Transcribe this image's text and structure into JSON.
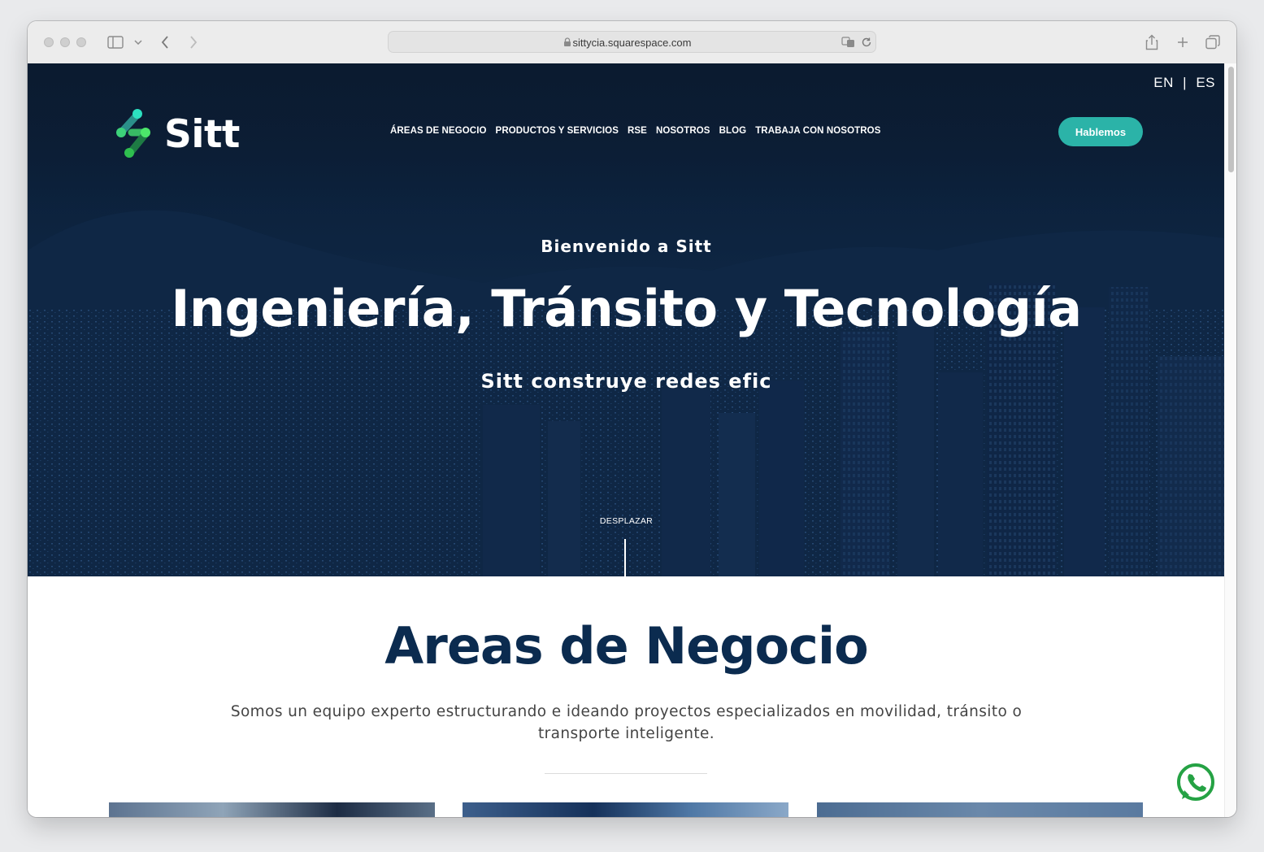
{
  "browser": {
    "url": "sittycia.squarespace.com"
  },
  "site": {
    "brand": "Sitt",
    "lang": {
      "en": "EN",
      "sep": "|",
      "es": "ES"
    },
    "nav": [
      "ÁREAS DE NEGOCIO",
      "PRODUCTOS Y SERVICIOS",
      "RSE",
      "NOSOTROS",
      "BLOG",
      "TRABAJA CON NOSOTROS"
    ],
    "cta": "Hablemos"
  },
  "hero": {
    "eyebrow": "Bienvenido a Sitt",
    "title": "Ingeniería, Tránsito y Tecnología",
    "subtitle": "Sitt construye redes efic",
    "scroll_label": "DESPLAZAR"
  },
  "areas": {
    "title": "Areas de Negocio",
    "description": "Somos un equipo experto estructurando e ideando proyectos especializados en movilidad, tránsito o transporte inteligente."
  },
  "colors": {
    "accent": "#2bb3a8",
    "heading": "#0b2b4f",
    "hero_bg": "#0d2440",
    "whatsapp": "#25a244"
  }
}
